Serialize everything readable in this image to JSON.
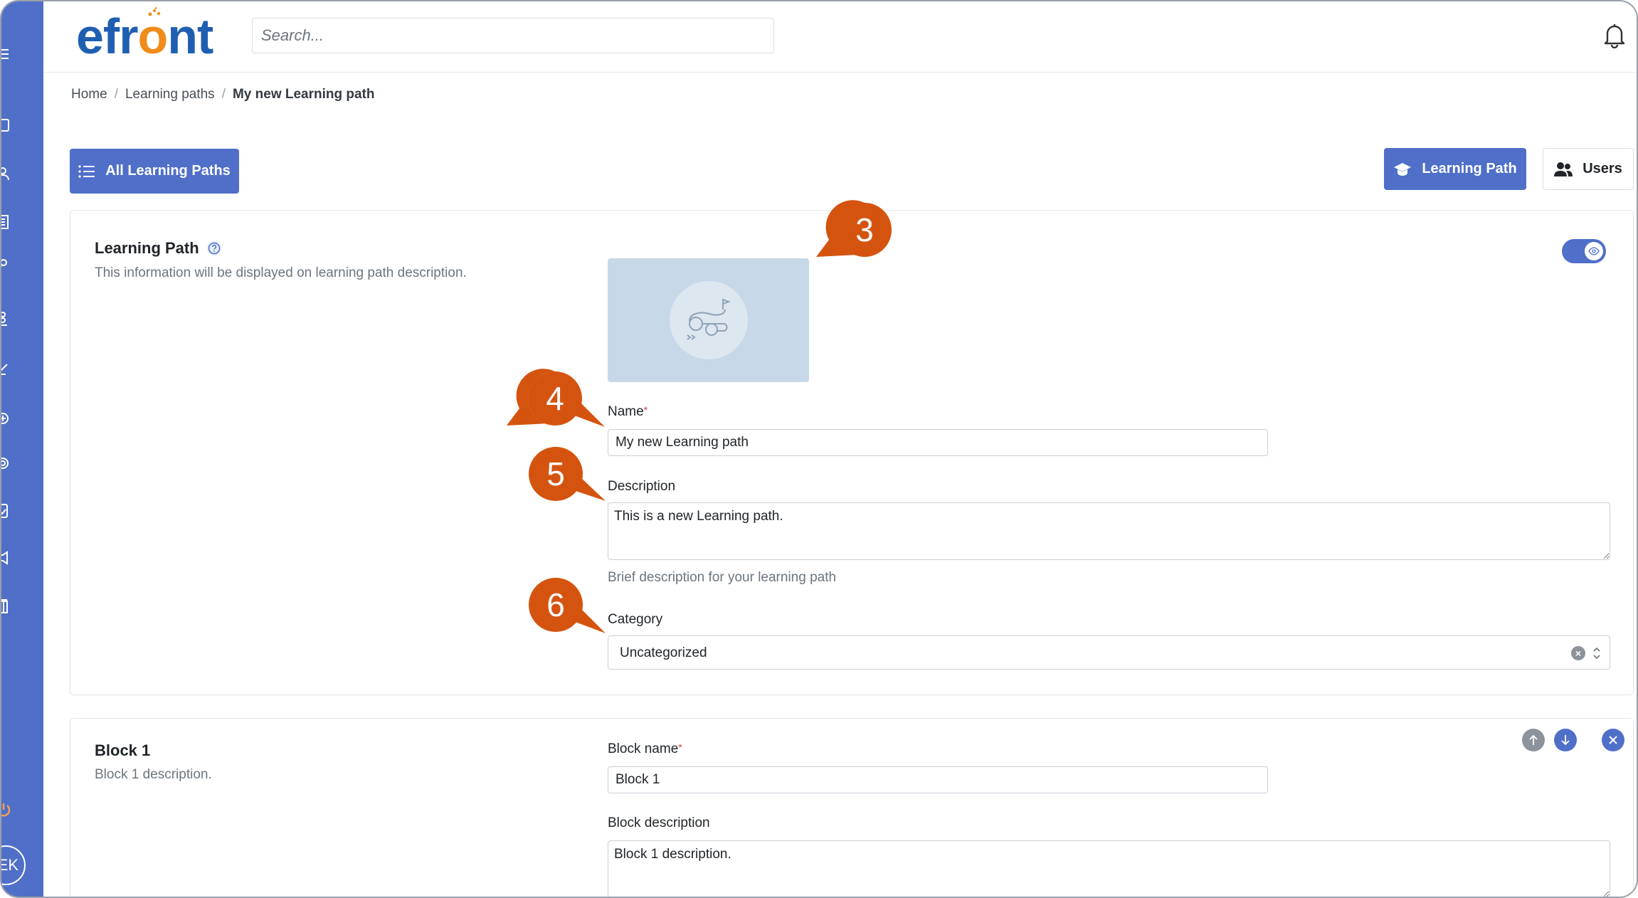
{
  "app": {
    "logo_text_pre": "efr",
    "logo_text_o": "o",
    "logo_text_post": "nt",
    "search_placeholder": "Search...",
    "avatar_initials": "EK",
    "brand_color": "#4f6fc8",
    "logo_orange": "#f08c1c"
  },
  "breadcrumb": {
    "home": "Home",
    "learning_paths": "Learning paths",
    "current": "My new Learning path",
    "separator": "/"
  },
  "toolbar": {
    "all_learning_paths": "All Learning Paths",
    "learning_path": "Learning Path",
    "users": "Users"
  },
  "learning_path_section": {
    "title": "Learning Path",
    "description": "This information will be displayed on learning path description.",
    "visible_toggle": true,
    "name_label": "Name",
    "name_value": "My new Learning path",
    "description_label": "Description",
    "description_value": "This is a new Learning path.",
    "description_help": "Brief description for your learning path",
    "category_label": "Category",
    "category_value": "Uncategorized",
    "required_mark": "*"
  },
  "block1": {
    "title": "Block 1",
    "description": "Block 1 description.",
    "name_label": "Block name",
    "name_value": "Block 1",
    "description_label": "Block description",
    "description_value": "Block 1 description."
  },
  "callouts": {
    "c3": "3",
    "c4": "4",
    "c5": "5",
    "c6": "6",
    "color": "#d4540f"
  }
}
